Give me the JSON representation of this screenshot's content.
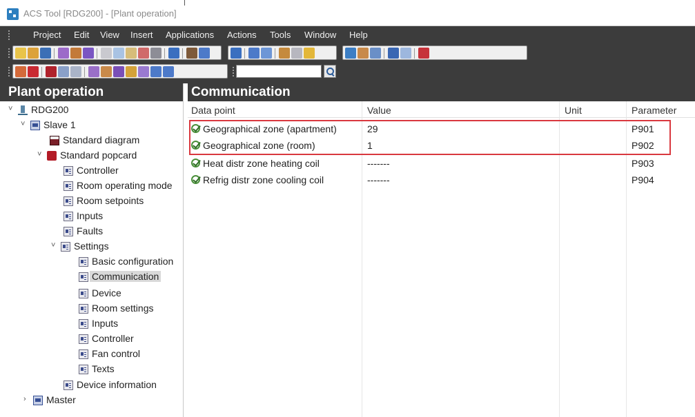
{
  "window": {
    "title": "ACS Tool [RDG200] - [Plant operation]"
  },
  "menu": {
    "items": [
      "Project",
      "Edit",
      "View",
      "Insert",
      "Applications",
      "Actions",
      "Tools",
      "Window",
      "Help"
    ]
  },
  "toolbar": {
    "search_value": ""
  },
  "left_panel": {
    "header": "Plant operation",
    "tree": [
      {
        "label": "RDG200",
        "icon": "plant-icon"
      },
      {
        "label": "Slave 1",
        "icon": "device-icon"
      },
      {
        "label": "Standard diagram",
        "icon": "diagram-icon"
      },
      {
        "label": "Standard popcard",
        "icon": "popcard-icon"
      },
      {
        "label": "Controller",
        "icon": "page-icon"
      },
      {
        "label": "Room operating mode",
        "icon": "page-icon"
      },
      {
        "label": "Room setpoints",
        "icon": "page-icon"
      },
      {
        "label": "Inputs",
        "icon": "page-icon"
      },
      {
        "label": "Faults",
        "icon": "page-icon"
      },
      {
        "label": "Settings",
        "icon": "page-icon"
      },
      {
        "label": "Basic configuration",
        "icon": "page-icon"
      },
      {
        "label": "Communication",
        "icon": "page-icon"
      },
      {
        "label": "Device",
        "icon": "page-icon"
      },
      {
        "label": "Room settings",
        "icon": "page-icon"
      },
      {
        "label": "Inputs",
        "icon": "page-icon"
      },
      {
        "label": "Controller",
        "icon": "page-icon"
      },
      {
        "label": "Fan control",
        "icon": "page-icon"
      },
      {
        "label": "Texts",
        "icon": "page-icon"
      },
      {
        "label": "Device information",
        "icon": "page-icon"
      },
      {
        "label": "Master",
        "icon": "device-icon"
      }
    ],
    "expanders": [
      "˅",
      "˅",
      "˅",
      "˅",
      "›"
    ]
  },
  "right_panel": {
    "header": "Communication",
    "columns": [
      "Data point",
      "Value",
      "Unit",
      "Parameter"
    ],
    "rows": [
      {
        "data_point": "Geographical zone (apartment)",
        "value": "29",
        "unit": "",
        "parameter": "P901"
      },
      {
        "data_point": "Geographical zone (room)",
        "value": "1",
        "unit": "",
        "parameter": "P902"
      },
      {
        "data_point": "Heat distr zone heating coil",
        "value": "-------",
        "unit": "",
        "parameter": "P903"
      },
      {
        "data_point": "Refrig distr zone cooling coil",
        "value": "-------",
        "unit": "",
        "parameter": "P904"
      }
    ],
    "highlight_color": "#d9383e"
  }
}
